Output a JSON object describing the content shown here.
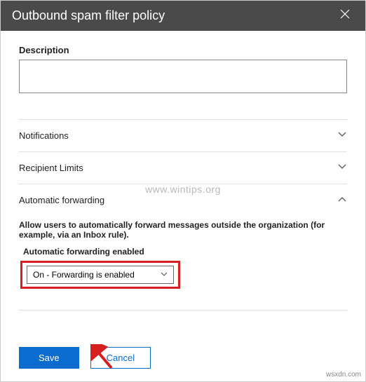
{
  "header": {
    "title": "Outbound spam filter policy"
  },
  "description": {
    "label": "Description",
    "value": ""
  },
  "sections": {
    "notifications": {
      "title": "Notifications"
    },
    "recipient_limits": {
      "title": "Recipient Limits"
    },
    "automatic_forwarding": {
      "title": "Automatic forwarding",
      "help_text": "Allow users to automatically forward messages outside the organization (for example, via an Inbox rule).",
      "dropdown_label": "Automatic forwarding enabled",
      "dropdown_value": "On - Forwarding is enabled"
    }
  },
  "footer": {
    "save_label": "Save",
    "cancel_label": "Cancel"
  },
  "watermark": "www.wintips.org",
  "attribution": "wsxdn.com"
}
